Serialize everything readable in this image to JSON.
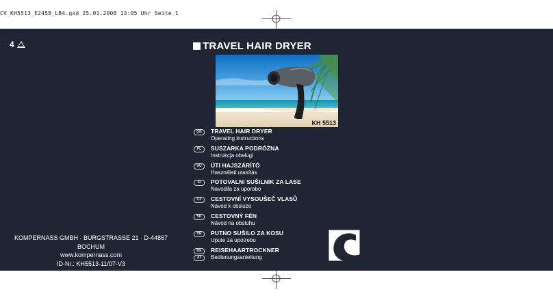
{
  "print_header": "CV_KH5513_E2458_LB4.qxd  25.01.2008  13:05 Uhr  Seite 1",
  "cover": {
    "page_number": "4",
    "page_marker_icon": "triangle-icon",
    "main_title": "TRAVEL HAIR DRYER",
    "model_label": "KH 5513",
    "company": {
      "address": "KOMPERNASS GMBH ·  BURGSTRASSE 21 · D-44867 BOCHUM",
      "website": "www.kompernass.com",
      "id": "ID-Nr.: KH5513-11/07-V3"
    },
    "languages": [
      {
        "code": "GB",
        "title": "TRAVEL HAIR DRYER",
        "subtitle": "Operating instructions"
      },
      {
        "code": "PL",
        "title": "SUSZARKA PODRÓŻNA",
        "subtitle": "Instrukcja obsługi"
      },
      {
        "code": "HU",
        "title": "ÚTI HAJSZÁRÍTÓ",
        "subtitle": "Használati utasítás"
      },
      {
        "code": "SI",
        "title": "POTOVALNI SUŠILNIK ZA LASE",
        "subtitle": "Navodila za uporabo"
      },
      {
        "code": "CZ",
        "title": "CESTOVNÍ VYSOUŠEČ VLASŮ",
        "subtitle": "Návod k obsluze"
      },
      {
        "code": "SK",
        "title": "CESTOVNÝ FÉN",
        "subtitle": "Návod na obsluhu"
      },
      {
        "code": "HR",
        "title": "PUTNO SUŠILO ZA KOSU",
        "subtitle": "Upute za upotrebu"
      },
      {
        "code": "DE",
        "code2": "AT",
        "title": "REISEHAARTROCKNER",
        "subtitle": "Bedienungsanleitung"
      }
    ],
    "colors": {
      "background": "#1f2532",
      "text": "#ffffff"
    }
  }
}
